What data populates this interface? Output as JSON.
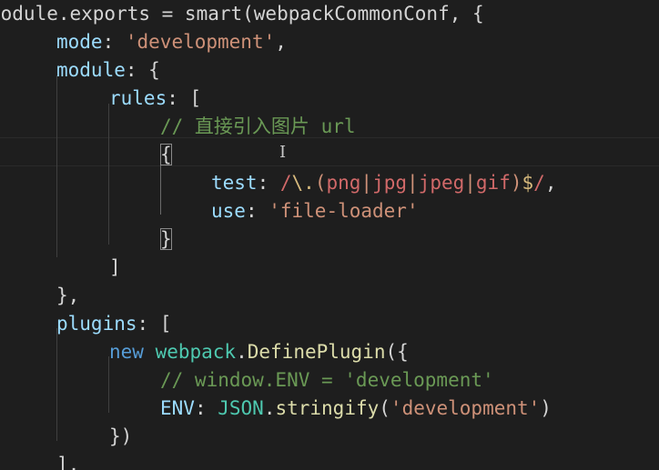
{
  "editor": {
    "lines": [
      [
        {
          "t": "module.exports = smart(webpackCommonConf, {",
          "c": "plain"
        }
      ],
      [
        {
          "t": "mode",
          "c": "prop"
        },
        {
          "t": ": ",
          "c": "pun"
        },
        {
          "t": "'development'",
          "c": "str"
        },
        {
          "t": ",",
          "c": "pun"
        }
      ],
      [
        {
          "t": "module",
          "c": "prop"
        },
        {
          "t": ": {",
          "c": "pun"
        }
      ],
      [
        {
          "t": "rules",
          "c": "prop"
        },
        {
          "t": ": [",
          "c": "pun"
        }
      ],
      [
        {
          "t": "// 直接引入图片 url",
          "c": "com"
        }
      ],
      [
        {
          "t": "{",
          "c": "pun",
          "box": true
        }
      ],
      [
        {
          "t": "test",
          "c": "prop"
        },
        {
          "t": ": ",
          "c": "pun"
        },
        {
          "t": "/",
          "c": "rx"
        },
        {
          "t": "\\.",
          "c": "rxe"
        },
        {
          "t": "(",
          "c": "rxg"
        },
        {
          "t": "png",
          "c": "rx"
        },
        {
          "t": "|",
          "c": "rxg"
        },
        {
          "t": "jpg",
          "c": "rx"
        },
        {
          "t": "|",
          "c": "rxg"
        },
        {
          "t": "jpeg",
          "c": "rx"
        },
        {
          "t": "|",
          "c": "rxg"
        },
        {
          "t": "gif",
          "c": "rx"
        },
        {
          "t": ")",
          "c": "rxg"
        },
        {
          "t": "$",
          "c": "rxe"
        },
        {
          "t": "/",
          "c": "rx"
        },
        {
          "t": ",",
          "c": "pun"
        }
      ],
      [
        {
          "t": "use",
          "c": "prop"
        },
        {
          "t": ": ",
          "c": "pun"
        },
        {
          "t": "'file-loader'",
          "c": "str"
        }
      ],
      [
        {
          "t": "}",
          "c": "pun",
          "box": true
        }
      ],
      [
        {
          "t": "]",
          "c": "pun"
        }
      ],
      [
        {
          "t": "},",
          "c": "pun"
        }
      ],
      [
        {
          "t": "plugins",
          "c": "prop"
        },
        {
          "t": ": [",
          "c": "pun"
        }
      ],
      [
        {
          "t": "new ",
          "c": "kw"
        },
        {
          "t": "webpack",
          "c": "cls"
        },
        {
          "t": ".",
          "c": "pun"
        },
        {
          "t": "DefinePlugin",
          "c": "fn"
        },
        {
          "t": "({",
          "c": "pun"
        }
      ],
      [
        {
          "t": "// window.ENV = 'development'",
          "c": "com"
        }
      ],
      [
        {
          "t": "ENV",
          "c": "prop"
        },
        {
          "t": ": ",
          "c": "pun"
        },
        {
          "t": "JSON",
          "c": "cls"
        },
        {
          "t": ".",
          "c": "pun"
        },
        {
          "t": "stringify",
          "c": "fn"
        },
        {
          "t": "(",
          "c": "pun"
        },
        {
          "t": "'development'",
          "c": "str"
        },
        {
          "t": ")",
          "c": "pun"
        }
      ],
      [
        {
          "t": "})",
          "c": "pun"
        }
      ],
      [
        {
          "t": "],",
          "c": "pun"
        }
      ]
    ]
  }
}
